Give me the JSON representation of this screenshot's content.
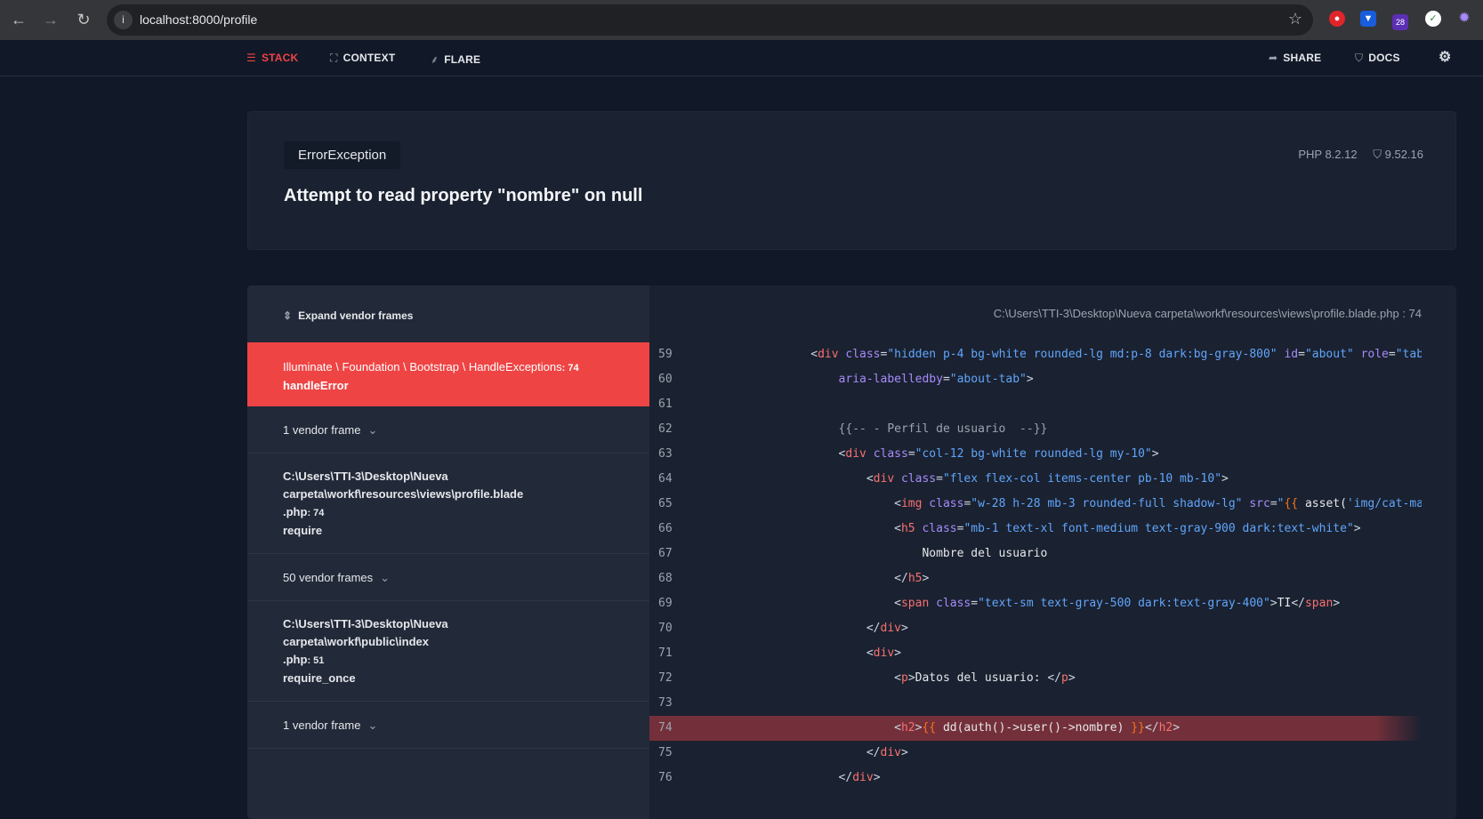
{
  "browser": {
    "url": "localhost:8000/profile",
    "extension_badge": "28"
  },
  "nav": {
    "stack": "STACK",
    "context": "CONTEXT",
    "flare": "FLARE",
    "share": "SHARE",
    "docs": "DOCS"
  },
  "error": {
    "type": "ErrorException",
    "message": "Attempt to read property \"nombre\" on null",
    "php_version": "PHP 8.2.12",
    "laravel_version": "9.52.16"
  },
  "frames": {
    "expand_label": "Expand vendor frames",
    "active": {
      "class": "Illuminate \\ Foundation \\ Bootstrap \\ HandleExceptions",
      "line": ": 74",
      "method": "handleError"
    },
    "vendor1": "1 vendor frame",
    "app1": {
      "path1": "C:\\Users\\TTI-3\\Desktop\\Nueva",
      "path2": "carpeta\\workf\\resources\\views\\profile.blade",
      "path3": ".php",
      "line": ": 74",
      "method": "require"
    },
    "vendor2": "50 vendor frames",
    "app2": {
      "path1": "C:\\Users\\TTI-3\\Desktop\\Nueva",
      "path2": "carpeta\\workf\\public\\index",
      "path3": ".php",
      "line": ": 51",
      "method": "require_once"
    },
    "vendor3": "1 vendor frame"
  },
  "code": {
    "file": "C:\\Users\\TTI-3\\Desktop\\Nueva carpeta\\workf\\resources\\views\\profile.blade.php : 74",
    "highlight_line": 74,
    "lines": [
      {
        "n": 59,
        "t": [
          [
            "x",
            "                "
          ],
          [
            "p",
            "<"
          ],
          [
            "t",
            "div"
          ],
          [
            "x",
            " "
          ],
          [
            "a",
            "class"
          ],
          [
            "p",
            "="
          ],
          [
            "s",
            "\"hidden p-4 bg-white rounded-lg md:p-8 dark:bg-gray-800\""
          ],
          [
            "x",
            " "
          ],
          [
            "a",
            "id"
          ],
          [
            "p",
            "="
          ],
          [
            "s",
            "\"about\""
          ],
          [
            "x",
            " "
          ],
          [
            "a",
            "role"
          ],
          [
            "p",
            "="
          ],
          [
            "s",
            "\"tabpanel\""
          ]
        ]
      },
      {
        "n": 60,
        "t": [
          [
            "x",
            "                    "
          ],
          [
            "a",
            "aria-labelledby"
          ],
          [
            "p",
            "="
          ],
          [
            "s",
            "\"about-tab\""
          ],
          [
            "p",
            ">"
          ]
        ]
      },
      {
        "n": 61,
        "t": []
      },
      {
        "n": 62,
        "t": [
          [
            "x",
            "                    "
          ],
          [
            "c",
            "{{-- - Perfil de usuario  --}}"
          ]
        ]
      },
      {
        "n": 63,
        "t": [
          [
            "x",
            "                    "
          ],
          [
            "p",
            "<"
          ],
          [
            "t",
            "div"
          ],
          [
            "x",
            " "
          ],
          [
            "a",
            "class"
          ],
          [
            "p",
            "="
          ],
          [
            "s",
            "\"col-12 bg-white rounded-lg my-10\""
          ],
          [
            "p",
            ">"
          ]
        ]
      },
      {
        "n": 64,
        "t": [
          [
            "x",
            "                        "
          ],
          [
            "p",
            "<"
          ],
          [
            "t",
            "div"
          ],
          [
            "x",
            " "
          ],
          [
            "a",
            "class"
          ],
          [
            "p",
            "="
          ],
          [
            "s",
            "\"flex flex-col items-center pb-10 mb-10\""
          ],
          [
            "p",
            ">"
          ]
        ]
      },
      {
        "n": 65,
        "t": [
          [
            "x",
            "                            "
          ],
          [
            "p",
            "<"
          ],
          [
            "t",
            "img"
          ],
          [
            "x",
            " "
          ],
          [
            "a",
            "class"
          ],
          [
            "p",
            "="
          ],
          [
            "s",
            "\"w-28 h-28 mb-3 rounded-full shadow-lg\""
          ],
          [
            "x",
            " "
          ],
          [
            "a",
            "src"
          ],
          [
            "p",
            "="
          ],
          [
            "s",
            "\""
          ],
          [
            "b",
            "{{"
          ],
          [
            "x",
            " asset("
          ],
          [
            "s",
            "'img/cat-masc.png'"
          ]
        ]
      },
      {
        "n": 66,
        "t": [
          [
            "x",
            "                            "
          ],
          [
            "p",
            "<"
          ],
          [
            "t",
            "h5"
          ],
          [
            "x",
            " "
          ],
          [
            "a",
            "class"
          ],
          [
            "p",
            "="
          ],
          [
            "s",
            "\"mb-1 text-xl font-medium text-gray-900 dark:text-white\""
          ],
          [
            "p",
            ">"
          ]
        ]
      },
      {
        "n": 67,
        "t": [
          [
            "x",
            "                                Nombre del usuario"
          ]
        ]
      },
      {
        "n": 68,
        "t": [
          [
            "x",
            "                            "
          ],
          [
            "p",
            "</"
          ],
          [
            "t",
            "h5"
          ],
          [
            "p",
            ">"
          ]
        ]
      },
      {
        "n": 69,
        "t": [
          [
            "x",
            "                            "
          ],
          [
            "p",
            "<"
          ],
          [
            "t",
            "span"
          ],
          [
            "x",
            " "
          ],
          [
            "a",
            "class"
          ],
          [
            "p",
            "="
          ],
          [
            "s",
            "\"text-sm text-gray-500 dark:text-gray-400\""
          ],
          [
            "p",
            ">"
          ],
          [
            "x",
            "TI"
          ],
          [
            "p",
            "</"
          ],
          [
            "t",
            "span"
          ],
          [
            "p",
            ">"
          ]
        ]
      },
      {
        "n": 70,
        "t": [
          [
            "x",
            "                        "
          ],
          [
            "p",
            "</"
          ],
          [
            "t",
            "div"
          ],
          [
            "p",
            ">"
          ]
        ]
      },
      {
        "n": 71,
        "t": [
          [
            "x",
            "                        "
          ],
          [
            "p",
            "<"
          ],
          [
            "t",
            "div"
          ],
          [
            "p",
            ">"
          ]
        ]
      },
      {
        "n": 72,
        "t": [
          [
            "x",
            "                            "
          ],
          [
            "p",
            "<"
          ],
          [
            "t",
            "p"
          ],
          [
            "p",
            ">"
          ],
          [
            "x",
            "Datos del usuario: "
          ],
          [
            "p",
            "</"
          ],
          [
            "t",
            "p"
          ],
          [
            "p",
            ">"
          ]
        ]
      },
      {
        "n": 73,
        "t": []
      },
      {
        "n": 74,
        "t": [
          [
            "x",
            "                            "
          ],
          [
            "p",
            "<"
          ],
          [
            "t",
            "h2"
          ],
          [
            "p",
            ">"
          ],
          [
            "b",
            "{{"
          ],
          [
            "x",
            " dd(auth()->user()->nombre) "
          ],
          [
            "b",
            "}}"
          ],
          [
            "p",
            "</"
          ],
          [
            "t",
            "h2"
          ],
          [
            "p",
            ">"
          ]
        ]
      },
      {
        "n": 75,
        "t": [
          [
            "x",
            "                        "
          ],
          [
            "p",
            "</"
          ],
          [
            "t",
            "div"
          ],
          [
            "p",
            ">"
          ]
        ]
      },
      {
        "n": 76,
        "t": [
          [
            "x",
            "                    "
          ],
          [
            "p",
            "</"
          ],
          [
            "t",
            "div"
          ],
          [
            "p",
            ">"
          ]
        ]
      }
    ]
  }
}
